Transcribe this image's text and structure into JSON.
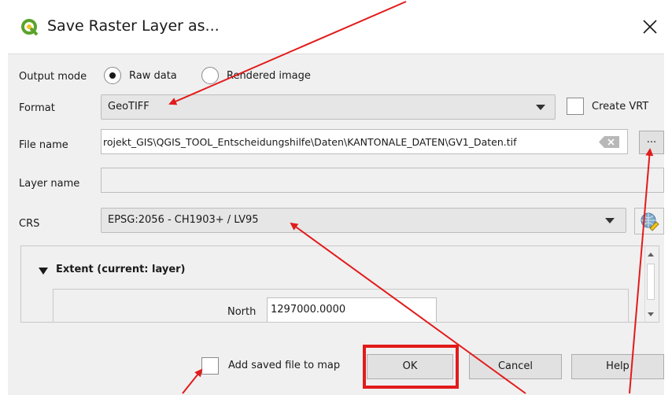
{
  "window": {
    "title": "Save Raster Layer as..."
  },
  "form": {
    "output_mode_label": "Output mode",
    "output_mode_options": [
      "Raw data",
      "Rendered image"
    ],
    "output_mode_selected": "Raw data",
    "format_label": "Format",
    "format_value": "GeoTIFF",
    "create_vrt_label": "Create VRT",
    "file_name_label": "File name",
    "file_name_value": "rojekt_GIS\\QGIS_TOOL_Entscheidungshilfe\\Daten\\KANTONALE_DATEN\\GV1_Daten.tif",
    "browse_label": "...",
    "layer_name_label": "Layer name",
    "layer_name_value": "",
    "crs_label": "CRS",
    "crs_value": "EPSG:2056 - CH1903+ / LV95"
  },
  "extent": {
    "header": "Extent (current: layer)",
    "north_label": "North",
    "north_value": "1297000.0000"
  },
  "footer": {
    "add_saved_label": "Add saved file to map",
    "ok_label": "OK",
    "cancel_label": "Cancel",
    "help_label": "Help"
  },
  "colors": {
    "annotation_red": "#e21b1b",
    "qgis_green": "#5aa32b",
    "qgis_yellow": "#f0c419"
  },
  "icons": {
    "app": "qgis-logo-icon",
    "close": "close-icon",
    "clear": "clear-text-icon",
    "crs_select": "globe-projection-icon",
    "collapse": "triangle-down-icon"
  }
}
